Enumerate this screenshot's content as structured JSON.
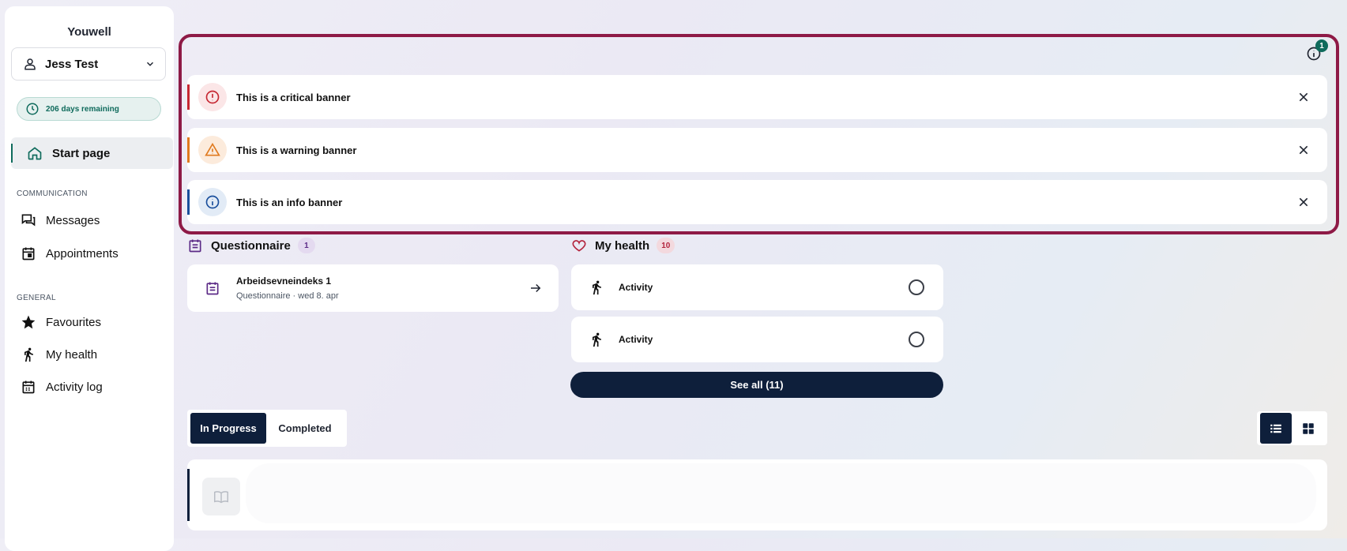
{
  "sidebar": {
    "brand": "Youwell",
    "user_name": "Jess Test",
    "days_remaining": "206 days remaining",
    "start_page": "Start page",
    "sections": [
      {
        "label": "COMMUNICATION",
        "items": [
          "Messages",
          "Appointments"
        ]
      },
      {
        "label": "GENERAL",
        "items": [
          "Favourites",
          "My health",
          "Activity log"
        ]
      }
    ]
  },
  "notifications": {
    "info_count": "1"
  },
  "banners": [
    {
      "text": "This is a critical banner",
      "type": "critical",
      "color": "#c62833",
      "icon": "alert-circle-icon"
    },
    {
      "text": "This is a warning banner",
      "type": "warning",
      "color": "#e07a1f",
      "icon": "warning-triangle-icon"
    },
    {
      "text": "This is an info banner",
      "type": "info",
      "color": "#1a4f9c",
      "icon": "info-circle-icon"
    }
  ],
  "questionnaire": {
    "title": "Questionnaire",
    "count": "1",
    "items": [
      {
        "title": "Arbeidsevneindeks 1",
        "subtitle": "Questionnaire · wed 8. apr"
      }
    ]
  },
  "my_health": {
    "title": "My health",
    "count": "10",
    "items": [
      {
        "label": "Activity"
      },
      {
        "label": "Activity"
      }
    ],
    "see_all": "See all (11)"
  },
  "tabs": {
    "in_progress": "In Progress",
    "completed": "Completed"
  },
  "colors": {
    "primary": "#0e1f3b",
    "accent": "#0f6b5c",
    "frame": "#8e1a46",
    "questionnaire": "#5b2a86",
    "health": "#b3243d"
  }
}
